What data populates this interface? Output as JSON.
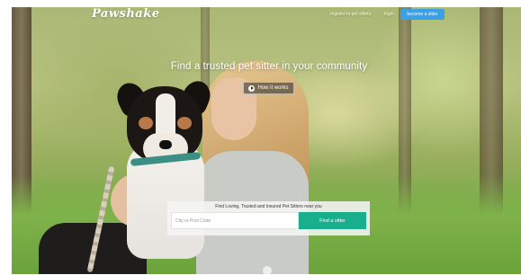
{
  "header": {
    "logo": "Pawshake",
    "nav": {
      "register_label": "register to pet sitters",
      "login_label": "login",
      "become_sitter_label": "become a sitter"
    }
  },
  "hero": {
    "headline": "Find a trusted pet sitter in your community",
    "how_it_works_label": "How it works"
  },
  "search": {
    "caption": "Find Loving, Trusted and Insured Pet Sitters near you",
    "placeholder": "City or Post Code",
    "button_label": "Find a sitter"
  },
  "colors": {
    "accent_blue": "#3aa0e8",
    "accent_green": "#1aaf8c"
  },
  "icons": {
    "play": "play-icon",
    "scroll": "scroll-down-icon"
  }
}
